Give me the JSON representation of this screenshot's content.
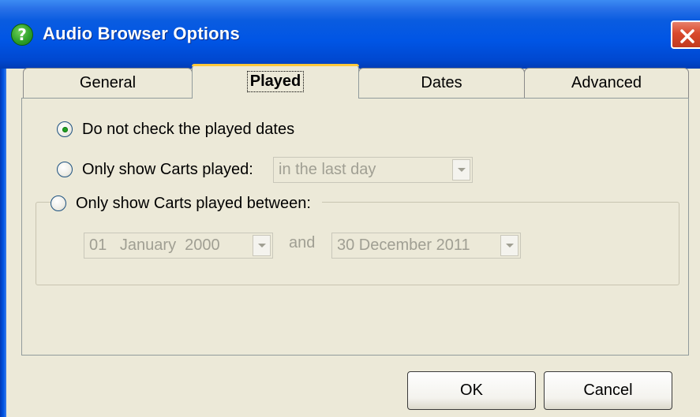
{
  "window": {
    "title": "Audio Browser Options",
    "help_icon": "question-mark-icon",
    "close_icon": "close-x-icon"
  },
  "tabs": [
    {
      "label": "General",
      "active": false
    },
    {
      "label": "Played",
      "active": true
    },
    {
      "label": "Dates",
      "active": false
    },
    {
      "label": "Advanced",
      "active": false
    }
  ],
  "played": {
    "option_no_check": {
      "label": "Do not check the played dates",
      "checked": true
    },
    "option_show_played": {
      "label": "Only show Carts played:",
      "checked": false,
      "combo_value": "in the last day"
    },
    "option_between": {
      "label": "Only show Carts played between:",
      "checked": false,
      "start_date": "01   January  2000",
      "and_label": "and",
      "end_date": "30 December 2011"
    }
  },
  "buttons": {
    "ok": "OK",
    "cancel": "Cancel"
  },
  "colors": {
    "titlebar": "#0055e5",
    "dialog_bg": "#ece9d8",
    "active_tab_highlight": "#ffc83c",
    "radio_check": "#21a121",
    "disabled_text": "#a09f93"
  }
}
